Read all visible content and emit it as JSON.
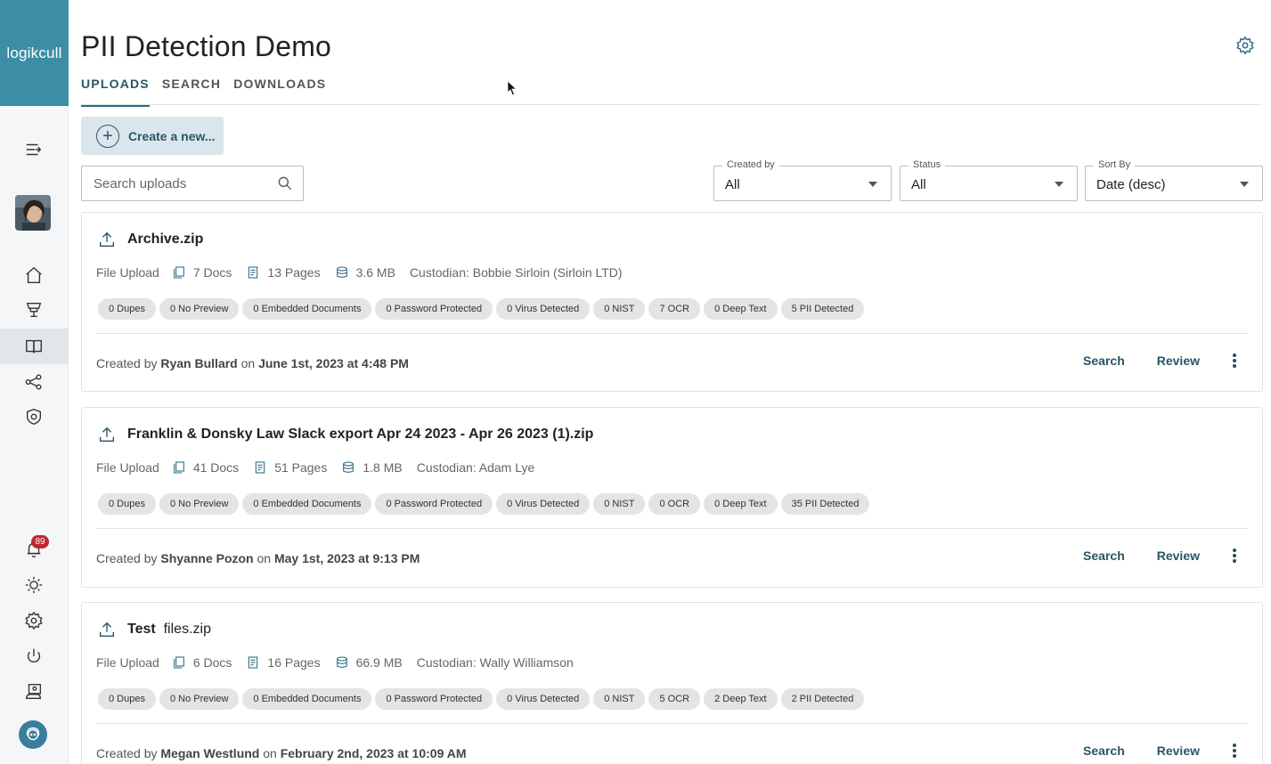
{
  "app": {
    "logo": "logikcull"
  },
  "sidebar": {
    "notification_count": "89",
    "icons": [
      "menu-collapse-icon",
      "home-icon",
      "trophy-icon",
      "book-icon",
      "share-network-icon",
      "shield-gear-icon",
      "bell-icon",
      "sun-icon",
      "gear-icon",
      "power-icon",
      "monitor-person-icon",
      "support-icon"
    ]
  },
  "header": {
    "title": "PII Detection Demo",
    "tabs": [
      {
        "label": "UPLOADS",
        "active": true
      },
      {
        "label": "SEARCH",
        "active": false
      },
      {
        "label": "DOWNLOADS",
        "active": false
      }
    ]
  },
  "toolbar": {
    "create_label": "Create a new...",
    "search_placeholder": "Search uploads",
    "filters": [
      {
        "label": "Created by",
        "value": "All"
      },
      {
        "label": "Status",
        "value": "All"
      },
      {
        "label": "Sort By",
        "value": "Date (desc)"
      }
    ]
  },
  "uploads": [
    {
      "title_bold": "Archive.zip",
      "title_light": "",
      "type": "File Upload",
      "docs": "7 Docs",
      "pages": "13 Pages",
      "size": "3.6 MB",
      "custodian": "Custodian: Bobbie Sirloin (Sirloin LTD)",
      "tags": [
        "0 Dupes",
        "0 No Preview",
        "0 Embedded Documents",
        "0 Password Protected",
        "0 Virus Detected",
        "0 NIST",
        "7 OCR",
        "0 Deep Text",
        "5 PII Detected"
      ],
      "created_prefix": "Created by",
      "created_by": "Ryan Bullard",
      "created_on_word": "on",
      "created_date": "June 1st, 2023 at 4:48 PM",
      "search_label": "Search",
      "review_label": "Review"
    },
    {
      "title_bold": "Franklin & Donsky Law Slack export Apr 24 2023 - Apr 26 2023 (1).zip",
      "title_light": "",
      "type": "File Upload",
      "docs": "41 Docs",
      "pages": "51 Pages",
      "size": "1.8 MB",
      "custodian": "Custodian: Adam Lye",
      "tags": [
        "0 Dupes",
        "0 No Preview",
        "0 Embedded Documents",
        "0 Password Protected",
        "0 Virus Detected",
        "0 NIST",
        "0 OCR",
        "0 Deep Text",
        "35 PII Detected"
      ],
      "created_prefix": "Created by",
      "created_by": "Shyanne Pozon",
      "created_on_word": "on",
      "created_date": "May 1st, 2023 at 9:13 PM",
      "search_label": "Search",
      "review_label": "Review"
    },
    {
      "title_bold": "Test",
      "title_light": "files.zip",
      "type": "File Upload",
      "docs": "6 Docs",
      "pages": "16 Pages",
      "size": "66.9 MB",
      "custodian": "Custodian: Wally Williamson",
      "tags": [
        "0 Dupes",
        "0 No Preview",
        "0 Embedded Documents",
        "0 Password Protected",
        "0 Virus Detected",
        "0 NIST",
        "5 OCR",
        "2 Deep Text",
        "2 PII Detected"
      ],
      "created_prefix": "Created by",
      "created_by": "Megan Westlund",
      "created_on_word": "on",
      "created_date": "February 2nd, 2023 at 10:09 AM",
      "search_label": "Search",
      "review_label": "Review"
    }
  ],
  "colors": {
    "logo_bg": "#3b8ea5",
    "accent": "#2b5566",
    "badge": "#c0272d"
  }
}
